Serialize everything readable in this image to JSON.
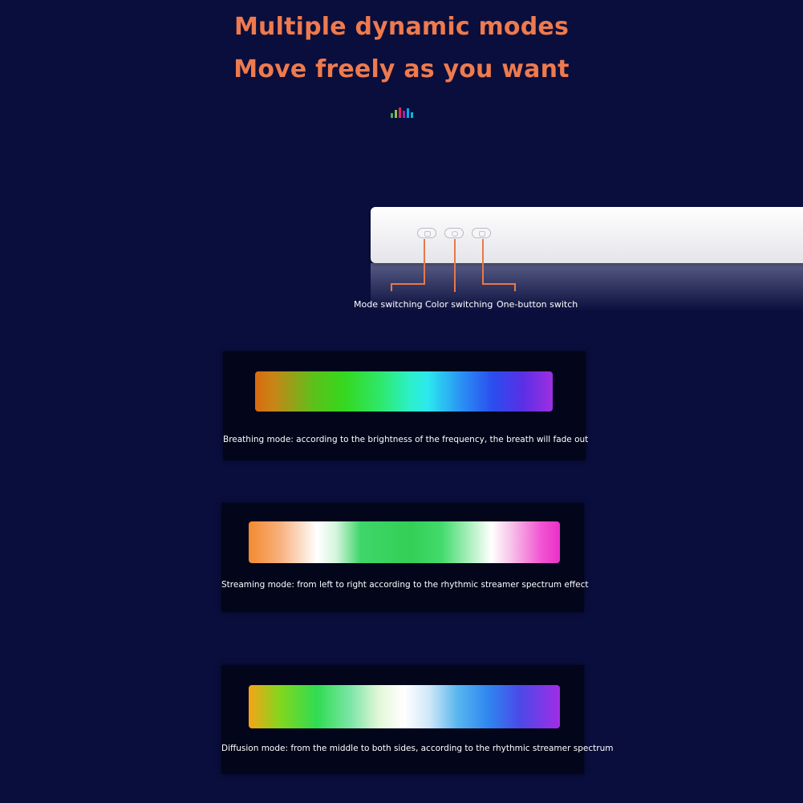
{
  "headline": {
    "line1": "Multiple dynamic modes",
    "line2": "Move freely as you want"
  },
  "decor": {
    "icon": "equalizer-icon"
  },
  "device": {
    "buttons": [
      {
        "label": "Mode switching"
      },
      {
        "label": "Color switching"
      },
      {
        "label": "One-button switch"
      }
    ]
  },
  "modes": [
    {
      "caption": "Breathing mode: according to the brightness of the frequency, the breath will fade out"
    },
    {
      "caption": "Streaming mode: from left to right according to the rhythmic streamer spectrum effect"
    },
    {
      "caption": "Diffusion mode: from the middle to both sides, according to the rhythmic streamer spectrum"
    }
  ],
  "colors": {
    "accent": "#ee7a4e",
    "background": "#0a0e3c",
    "panel": "#03051a"
  }
}
